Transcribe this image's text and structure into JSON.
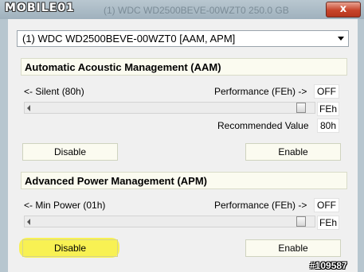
{
  "window": {
    "watermark": "MOBILE01",
    "ghost_title": "(1) WDC WD2500BEVE-00WZT0   250.0 GB",
    "close_glyph": "x"
  },
  "drive_selector": {
    "selected": "(1) WDC WD2500BEVE-00WZT0 [AAM, APM]"
  },
  "aam": {
    "title": "Automatic Acoustic Management (AAM)",
    "min_label": "<- Silent (80h)",
    "max_label": "Performance (FEh) ->",
    "status": "OFF",
    "current_value": "FEh",
    "slider_level": 0.97,
    "recommended_label": "Recommended Value",
    "recommended_value": "80h",
    "disable_label": "Disable",
    "enable_label": "Enable"
  },
  "apm": {
    "title": "Advanced Power Management (APM)",
    "min_label": "<- Min Power (01h)",
    "max_label": "Performance (FEh) ->",
    "status": "OFF",
    "current_value": "FEh",
    "slider_level": 0.97,
    "disable_label": "Disable",
    "enable_label": "Enable"
  },
  "footer": {
    "image_id": "#109587"
  },
  "colors": {
    "highlight": "#f8f04a",
    "close_button": "#c7442a"
  },
  "icons": [
    "close-icon",
    "dropdown-arrow-icon",
    "slider-left-arrow-icon"
  ]
}
